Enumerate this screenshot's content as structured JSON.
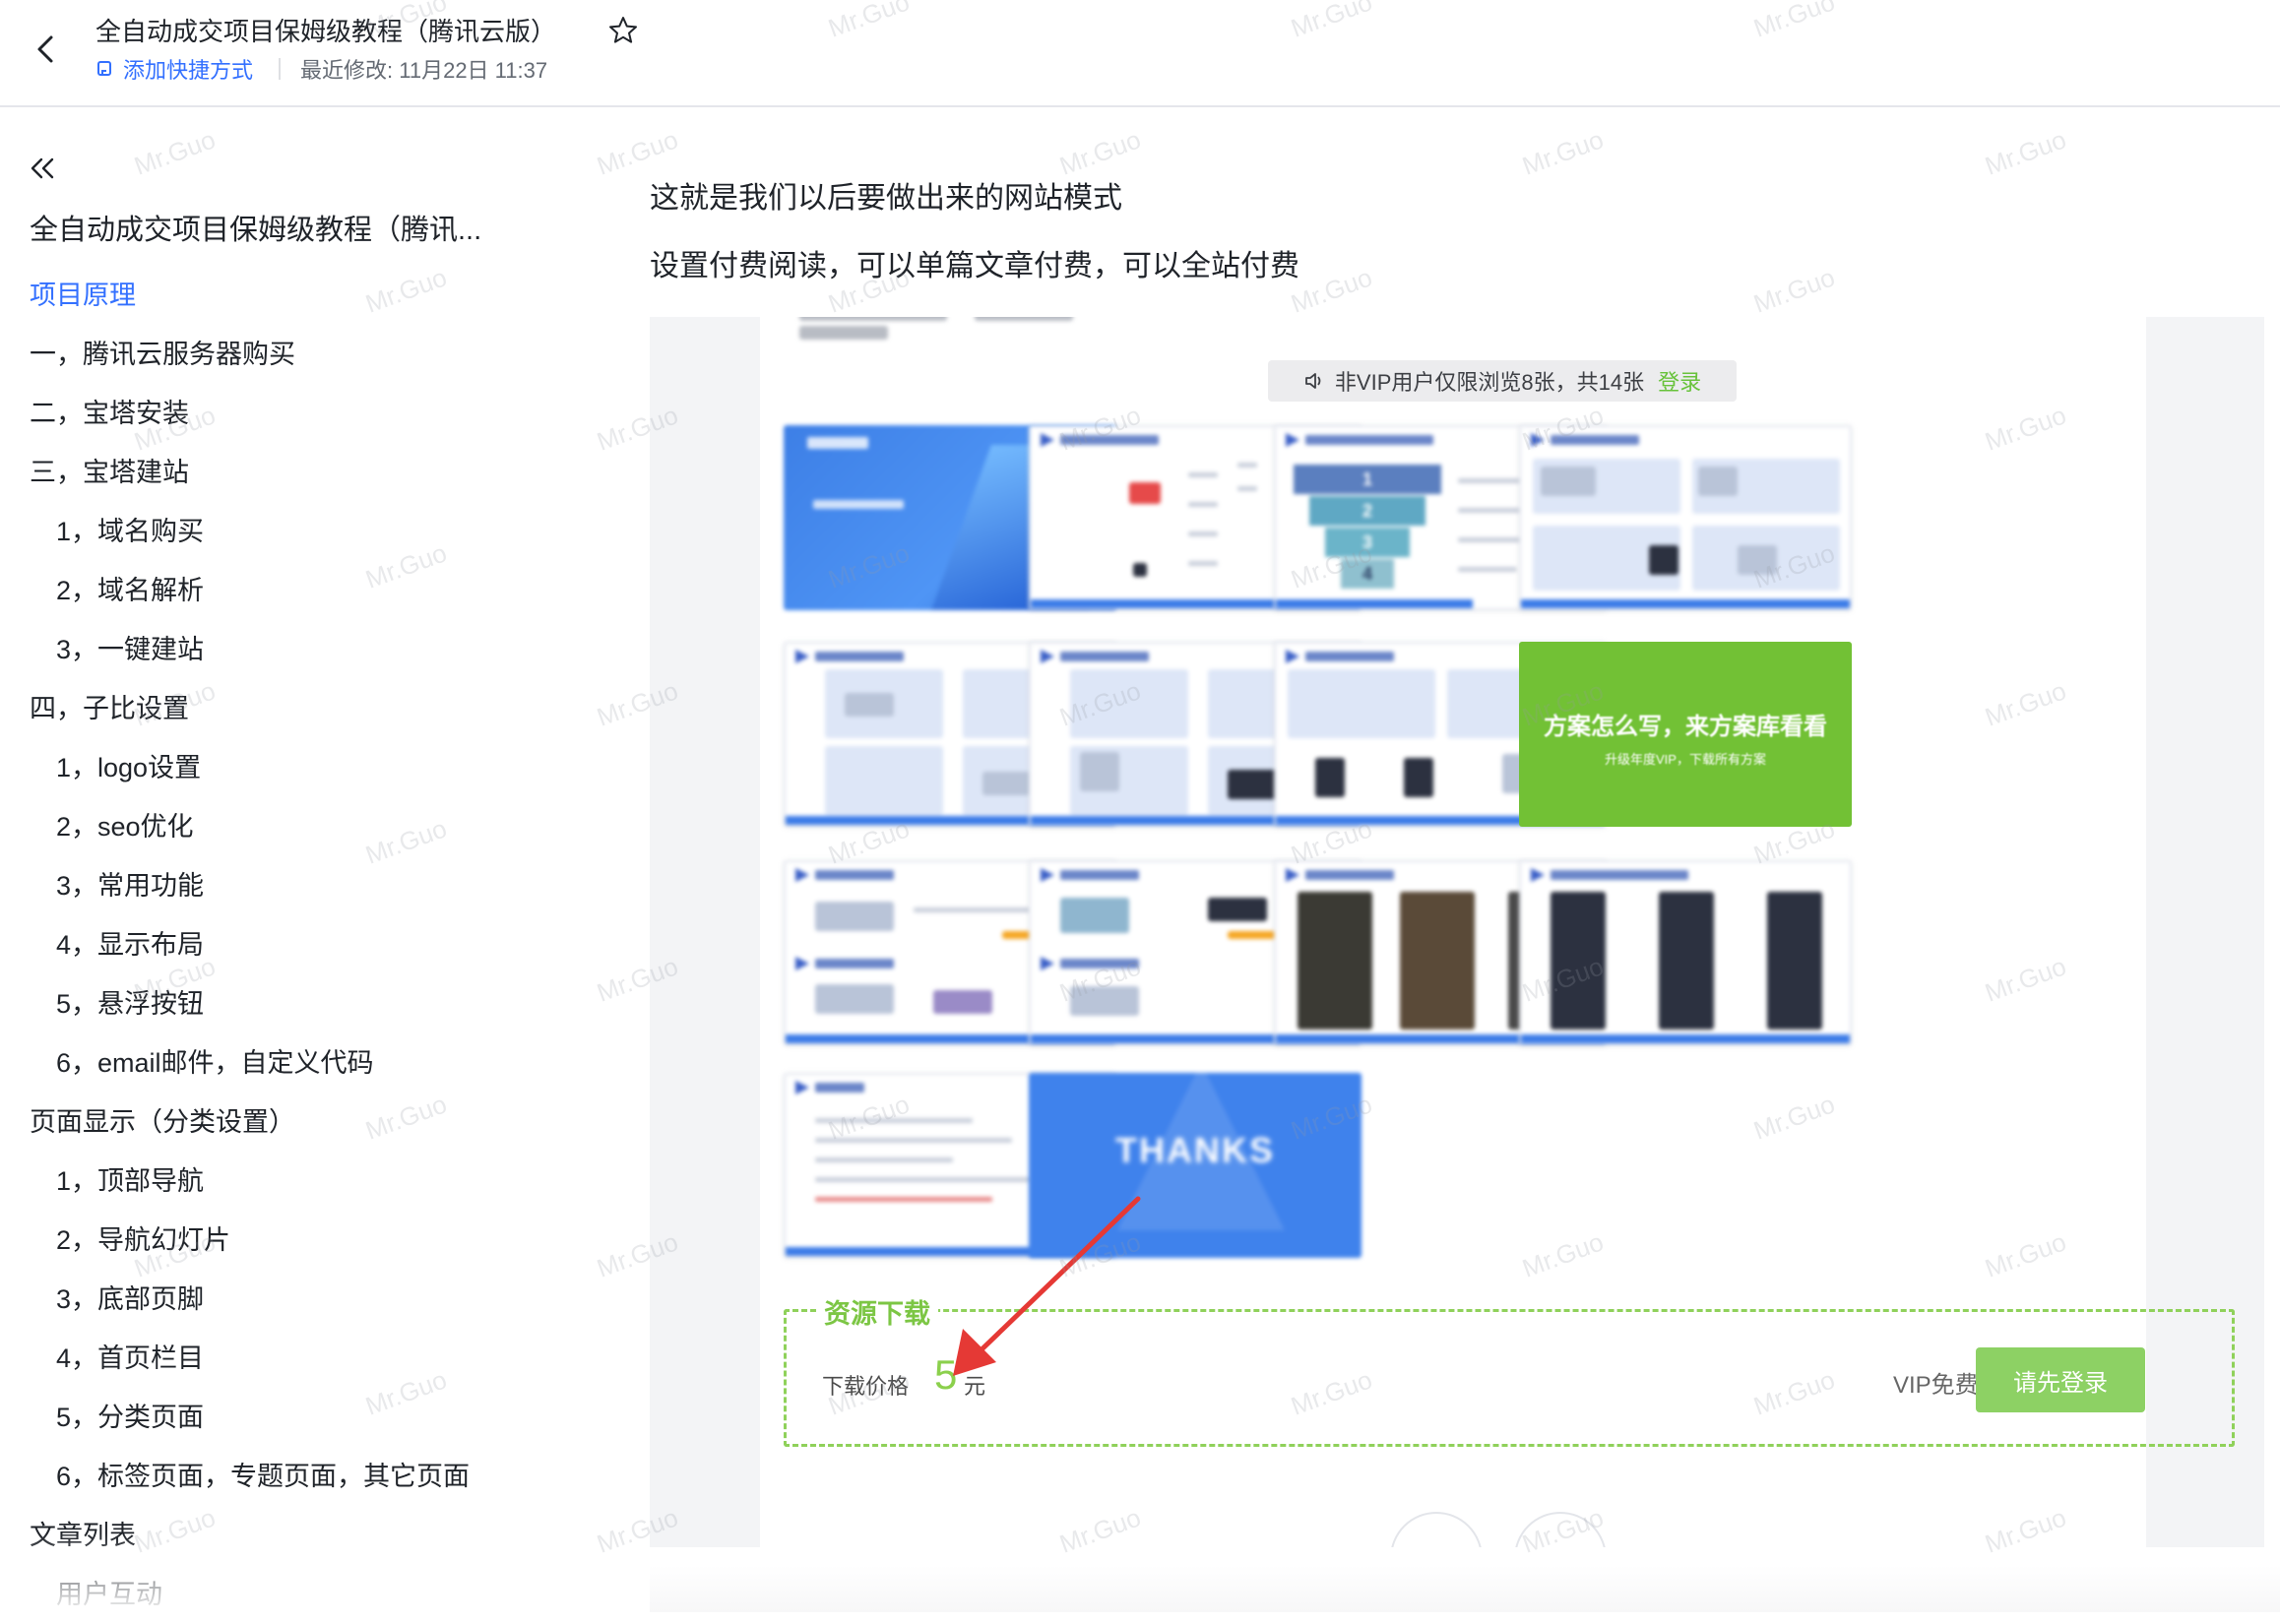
{
  "header": {
    "title": "全自动成交项目保姆级教程（腾讯云版）",
    "shortcut_label": "添加快捷方式",
    "last_modified": "最近修改: 11月22日 11:37"
  },
  "sidebar": {
    "toc_title": "全自动成交项目保姆级教程（腾讯...",
    "items": [
      {
        "label": "项目原理"
      },
      {
        "label": "一，腾讯云服务器购买"
      },
      {
        "label": "二，宝塔安装"
      },
      {
        "label": "三，宝塔建站"
      },
      {
        "label": "1，域名购买"
      },
      {
        "label": "2，域名解析"
      },
      {
        "label": "3，一键建站"
      },
      {
        "label": "四，子比设置"
      },
      {
        "label": "1，logo设置"
      },
      {
        "label": "2，seo优化"
      },
      {
        "label": "3，常用功能"
      },
      {
        "label": "4，显示布局"
      },
      {
        "label": "5，悬浮按钮"
      },
      {
        "label": "6，email邮件，自定义代码"
      },
      {
        "label": "页面显示（分类设置）"
      },
      {
        "label": "1，顶部导航"
      },
      {
        "label": "2，导航幻灯片"
      },
      {
        "label": "3，底部页脚"
      },
      {
        "label": "4，首页栏目"
      },
      {
        "label": "5，分类页面"
      },
      {
        "label": "6，标签页面，专题页面，其它页面"
      },
      {
        "label": "文章列表"
      },
      {
        "label": "用户互动"
      }
    ]
  },
  "content": {
    "para1": "这就是我们以后要做出来的网站模式",
    "para2": "设置付费阅读，可以单篇文章付费，可以全站付费"
  },
  "screenshot": {
    "vip_notice": "非VIP用户仅限浏览8张，共14张",
    "vip_login": "登录",
    "green_card_title": "方案怎么写，来方案库看看",
    "green_card_sub": "升级年度VIP，下载所有方案",
    "thanks_text": "THANKS",
    "funnel_levels": [
      "1",
      "2",
      "3",
      "4"
    ],
    "resource_title": "资源下载",
    "price_label": "下载价格",
    "price_value": "5",
    "price_unit": "元",
    "vip_free": "VIP免费",
    "login_button": "请先登录"
  },
  "watermark_text": "Mr.Guo",
  "colors": {
    "accent": "#3370ff",
    "green": "#8dd164",
    "arrow": "#e53935"
  }
}
